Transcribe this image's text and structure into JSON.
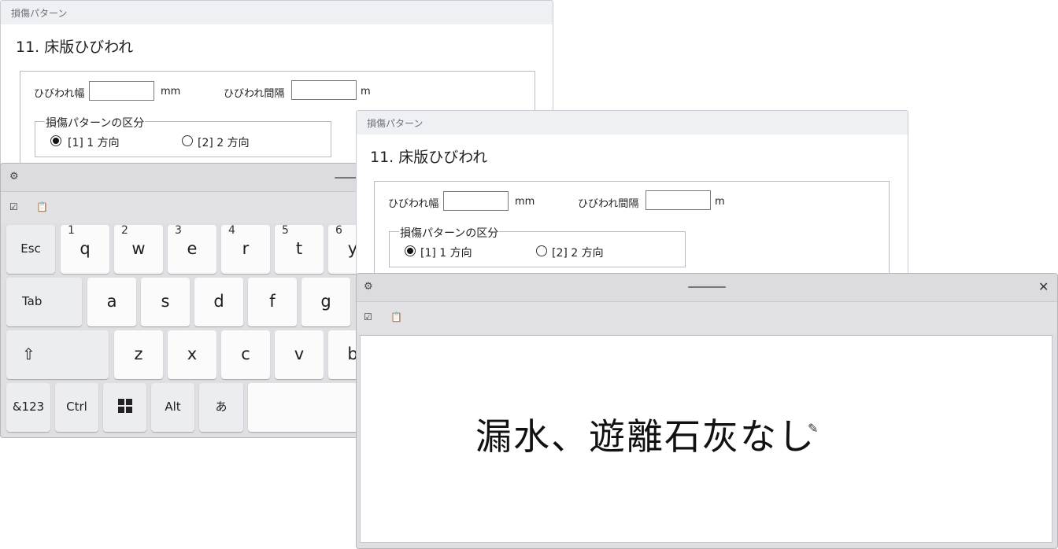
{
  "form_back": {
    "header": "損傷パターン",
    "title": "11. 床版ひびわれ",
    "crack_width_label": "ひびわれ幅",
    "crack_width_unit": "mm",
    "crack_spacing_label": "ひびわれ間隔",
    "crack_spacing_unit": "m",
    "group_label": "損傷パターンの区分",
    "option1": "[1] 1 方向",
    "option2": "[2] 2 方向"
  },
  "form_front": {
    "header": "損傷パターン",
    "title": "11. 床版ひびわれ",
    "crack_width_label": "ひびわれ幅",
    "crack_width_unit": "mm",
    "crack_spacing_label": "ひびわれ間隔",
    "crack_spacing_unit": "m",
    "group_label": "損傷パターンの区分",
    "option1": "[1] 1 方向",
    "option2": "[2] 2 方向"
  },
  "keyboard": {
    "settings_icon": "gear-icon",
    "row1": [
      {
        "label": "Esc"
      },
      {
        "label": "q",
        "num": "1"
      },
      {
        "label": "w",
        "num": "2"
      },
      {
        "label": "e",
        "num": "3"
      },
      {
        "label": "r",
        "num": "4"
      },
      {
        "label": "t",
        "num": "5"
      },
      {
        "label": "y",
        "num": "6"
      }
    ],
    "row2": [
      "Tab",
      "a",
      "s",
      "d",
      "f",
      "g"
    ],
    "row3": [
      "z",
      "x",
      "c",
      "v",
      "b"
    ],
    "shift_icon": "shift-icon",
    "row4": [
      "&123",
      "Ctrl",
      "Alt",
      "あ"
    ],
    "windows_icon": "windows-icon"
  },
  "handwriting": {
    "text": "漏水、遊離石灰なし",
    "close_icon": "close-icon",
    "pen_icon": "pen-icon"
  }
}
